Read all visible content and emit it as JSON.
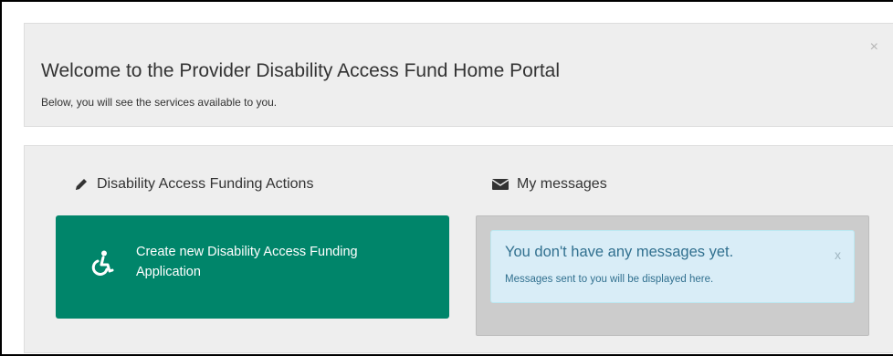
{
  "welcome": {
    "title": "Welcome to the Provider Disability Access Fund Home Portal",
    "subtitle": "Below, you will see the services available to you.",
    "close_label": "×"
  },
  "actions": {
    "heading": "Disability Access Funding Actions",
    "heading_icon": "pencil-icon",
    "create_button_label": "Create new Disability Access Funding Application",
    "create_button_icon": "wheelchair-icon",
    "button_color": "#00856a"
  },
  "messages": {
    "heading": "My messages",
    "heading_icon": "envelope-icon",
    "alert_title": "You don't have any messages yet.",
    "alert_text": "Messages sent to you will be displayed here.",
    "alert_close": "x"
  }
}
